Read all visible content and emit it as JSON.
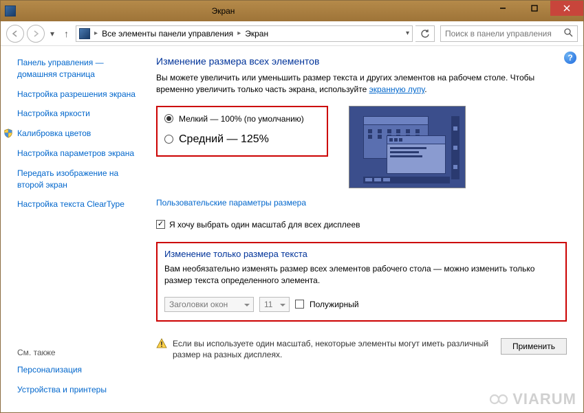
{
  "titlebar": {
    "title": "Экран"
  },
  "nav": {
    "breadcrumb1": "Все элементы панели управления",
    "breadcrumb2": "Экран",
    "search_placeholder": "Поиск в панели управления"
  },
  "sidebar": {
    "home": "Панель управления — домашняя страница",
    "links": [
      "Настройка разрешения экрана",
      "Настройка яркости",
      "Калибровка цветов",
      "Настройка параметров экрана",
      "Передать изображение на второй экран",
      "Настройка текста ClearType"
    ],
    "see_also_label": "См. также",
    "see_also": [
      "Персонализация",
      "Устройства и принтеры"
    ]
  },
  "main": {
    "heading": "Изменение размера всех элементов",
    "desc_pre": "Вы можете увеличить или уменьшить размер текста и других элементов на рабочем столе. Чтобы временно увеличить только часть экрана, используйте ",
    "desc_link": "экранную лупу",
    "radio_small": "Мелкий — 100% (по умолчанию)",
    "radio_medium": "Средний — 125%",
    "custom_link": "Пользовательские параметры размера",
    "single_scale": "Я хочу выбрать один масштаб для всех дисплеев",
    "heading2": "Изменение только размера текста",
    "desc2": "Вам необязательно изменять размер всех элементов рабочего стола — можно изменить только размер текста определенного элемента.",
    "select_element": "Заголовки окон",
    "select_size": "11",
    "bold_label": "Полужирный",
    "warning": "Если вы используете один масштаб, некоторые элементы могут иметь различный размер на разных дисплеях.",
    "apply": "Применить"
  },
  "watermark": "VIARUM"
}
